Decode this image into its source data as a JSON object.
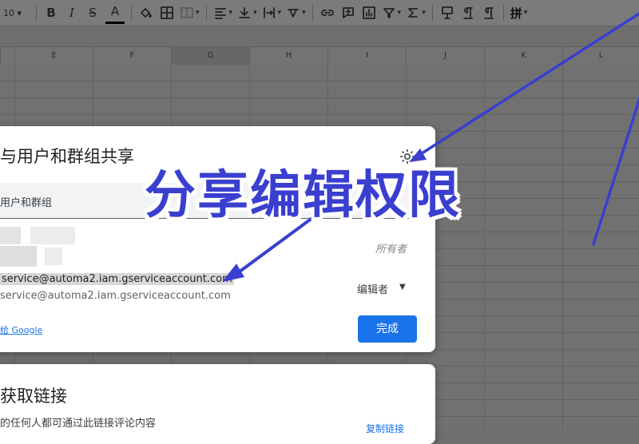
{
  "toolbar": {
    "font_size": "10",
    "bold_label": "B",
    "italic_label": "I",
    "strike_label": "S",
    "text_color_label": "A",
    "pinyin_label": "拼"
  },
  "grid": {
    "columns": [
      "E",
      "F",
      "G",
      "H",
      "I",
      "J",
      "K",
      "L"
    ],
    "selected_column": "G"
  },
  "share_dialog": {
    "title": "与用户和群组共享",
    "add_people_placeholder": "用户和群组",
    "owner_label": "所有者",
    "service_email_highlighted": "service@automa2.iam.gserviceaccount.com",
    "service_email": "service@automa2.iam.gserviceaccount.com",
    "role_label": "编辑者",
    "google_link": "给 Google",
    "done_button": "完成"
  },
  "link_dialog": {
    "title": "获取链接",
    "description": "的任何人都可通过此链接评论内容",
    "copy_link": "复制链接"
  },
  "caption": {
    "text": "分享编辑权限",
    "color": "#3a3fcf"
  },
  "colors": {
    "accent": "#1a73e8",
    "arrow": "#3a3fcf"
  }
}
